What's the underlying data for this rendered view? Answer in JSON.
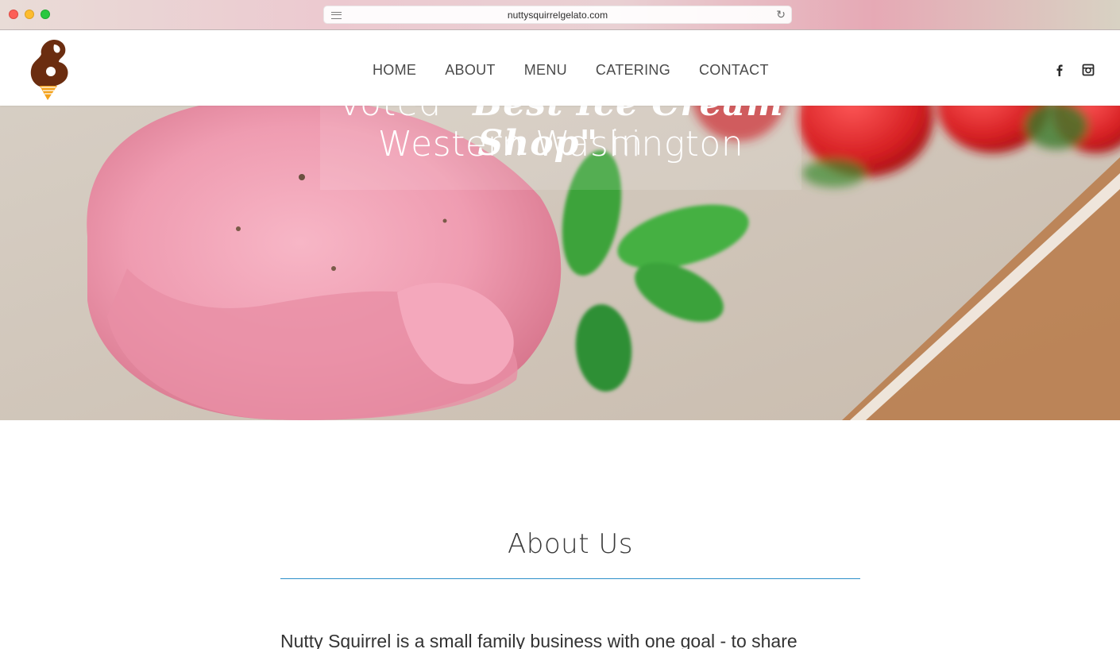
{
  "browser": {
    "url": "nuttysquirrelgelato.com"
  },
  "header": {
    "logo_name": "squirrel-cone-logo",
    "nav": [
      {
        "label": "HOME"
      },
      {
        "label": "ABOUT"
      },
      {
        "label": "MENU"
      },
      {
        "label": "CATERING"
      },
      {
        "label": "CONTACT"
      }
    ],
    "social": [
      "facebook-icon",
      "instagram-icon"
    ]
  },
  "hero": {
    "line1_prefix": "Voted ",
    "line1_script": "\"Best Ice Cream Shop\"",
    "line1_suffix": " in",
    "line2": "Western Washington",
    "image": "strawberry-gelato-scoop-with-mint-and-strawberries"
  },
  "about": {
    "title": "About Us",
    "intro": "Nutty Squirrel is a small family business with one goal - to share",
    "accent_color": "#2c8fc9"
  }
}
